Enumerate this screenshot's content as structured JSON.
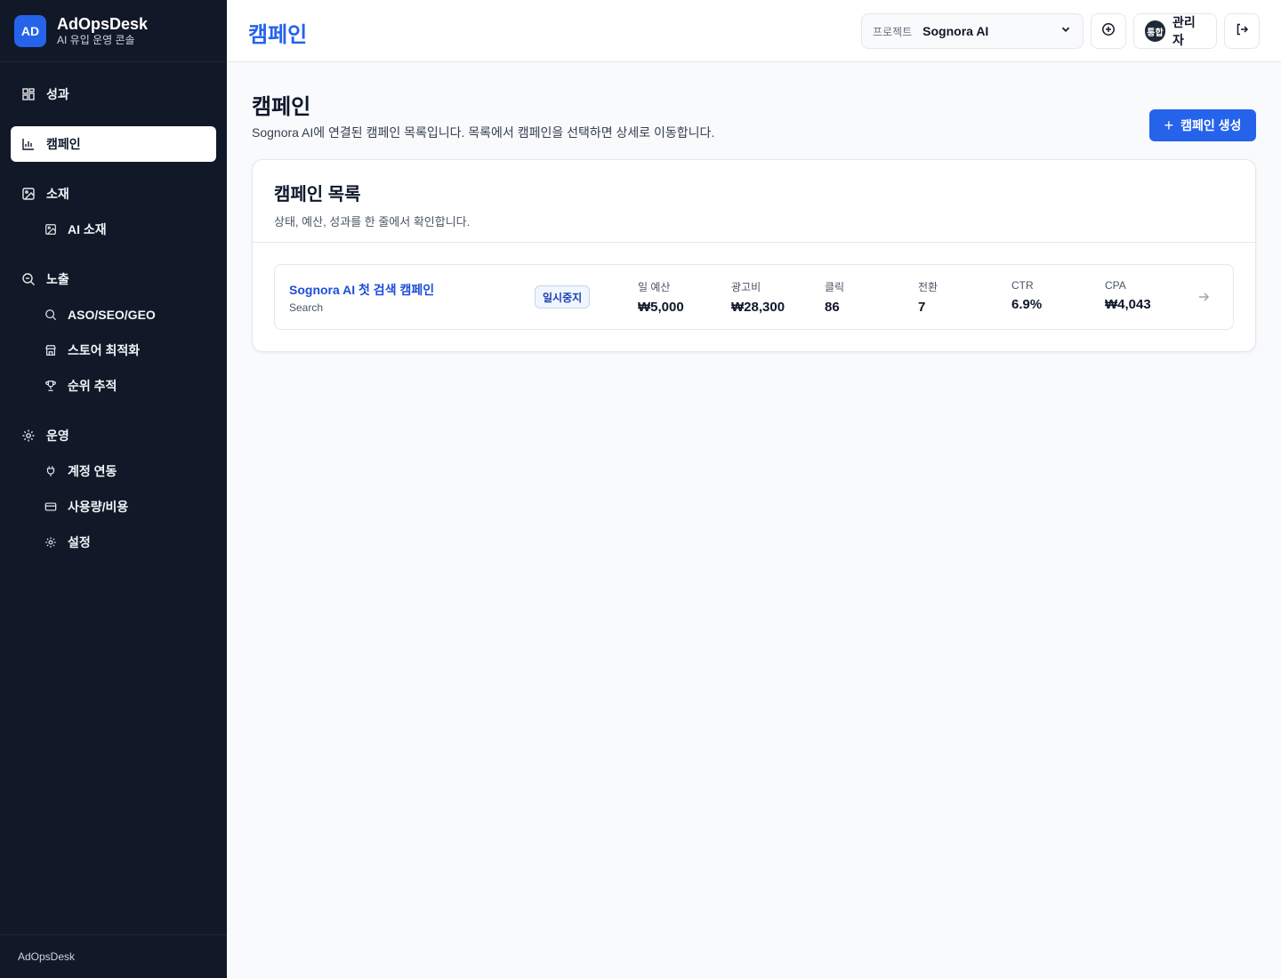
{
  "brand": {
    "logo": "AD",
    "name": "AdOpsDesk",
    "subtitle": "AI 유입 운영 콘솔"
  },
  "sidebar": {
    "items": [
      {
        "label": "성과",
        "icon": "grid-icon",
        "active": false
      },
      {
        "label": "캠페인",
        "icon": "bar-chart-icon",
        "active": true
      },
      {
        "label": "소재",
        "icon": "image-icon",
        "active": false
      },
      {
        "label": "AI 소재",
        "icon": "image-icon",
        "sub": true
      },
      {
        "label": "노출",
        "icon": "search-zoom-icon",
        "active": false
      },
      {
        "label": "ASO/SEO/GEO",
        "icon": "search-icon",
        "sub": true
      },
      {
        "label": "스토어 최적화",
        "icon": "store-icon",
        "sub": true
      },
      {
        "label": "순위 추적",
        "icon": "trophy-icon",
        "sub": true
      },
      {
        "label": "운영",
        "icon": "gear-icon",
        "active": false
      },
      {
        "label": "계정 연동",
        "icon": "plug-icon",
        "sub": true
      },
      {
        "label": "사용량/비용",
        "icon": "card-icon",
        "sub": true
      },
      {
        "label": "설정",
        "icon": "gear-icon",
        "sub": true
      }
    ],
    "footer": "AdOpsDesk"
  },
  "header": {
    "title": "캠페인",
    "project_label": "프로젝트",
    "project_value": "Sognora AI",
    "user_badge": "통합",
    "user_name": "관리자"
  },
  "main": {
    "title": "캠페인",
    "description": "Sognora AI에 연결된 캠페인 목록입니다. 목록에서 캠페인을 선택하면 상세로 이동합니다.",
    "create_button": "캠페인 생성",
    "card": {
      "title": "캠페인 목록",
      "subtitle": "상태, 예산, 성과를 한 줄에서 확인합니다.",
      "campaigns": [
        {
          "name": "Sognora AI 첫 검색 캠페인",
          "type": "Search",
          "status": "일시중지",
          "metrics": [
            {
              "label": "일 예산",
              "value": "₩5,000"
            },
            {
              "label": "광고비",
              "value": "₩28,300"
            },
            {
              "label": "클릭",
              "value": "86"
            },
            {
              "label": "전환",
              "value": "7"
            },
            {
              "label": "CTR",
              "value": "6.9%"
            },
            {
              "label": "CPA",
              "value": "₩4,043"
            }
          ]
        }
      ]
    }
  },
  "colors": {
    "accent": "#2563eb",
    "sidebar_bg": "#111827"
  }
}
